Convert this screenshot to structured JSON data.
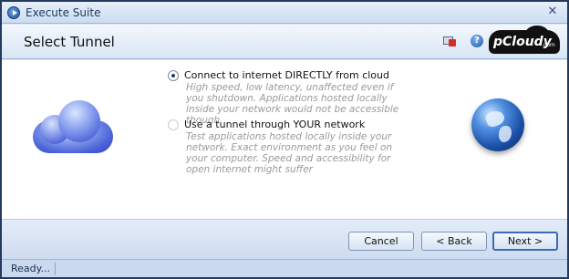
{
  "window": {
    "title": "Execute Suite",
    "close_glyph": "✕"
  },
  "header": {
    "title": "Select Tunnel",
    "help_glyph": "?",
    "logo": {
      "text": "pCloudy",
      "suffix": ".com"
    }
  },
  "options": [
    {
      "label": "Connect to internet DIRECTLY from cloud",
      "selected": true,
      "description": "High speed, low latency, unaffected even if you shutdown. Applications hosted locally inside your network would not be accessible though"
    },
    {
      "label": "Use a tunnel through YOUR network",
      "selected": false,
      "description": "Test applications hosted locally inside your network. Exact environment as you feel on your computer. Speed and accessibility for open internet might suffer"
    }
  ],
  "buttons": {
    "cancel": "Cancel",
    "back": "< Back",
    "next": "Next >"
  },
  "status": {
    "text": "Ready..."
  },
  "colors": {
    "title_bar": "#cbdcf1",
    "accent": "#3c6bb6",
    "background": "#dbe7f6"
  },
  "icons": [
    "execute-icon",
    "network-icon",
    "help-icon",
    "cloud-icon",
    "globe-icon"
  ]
}
